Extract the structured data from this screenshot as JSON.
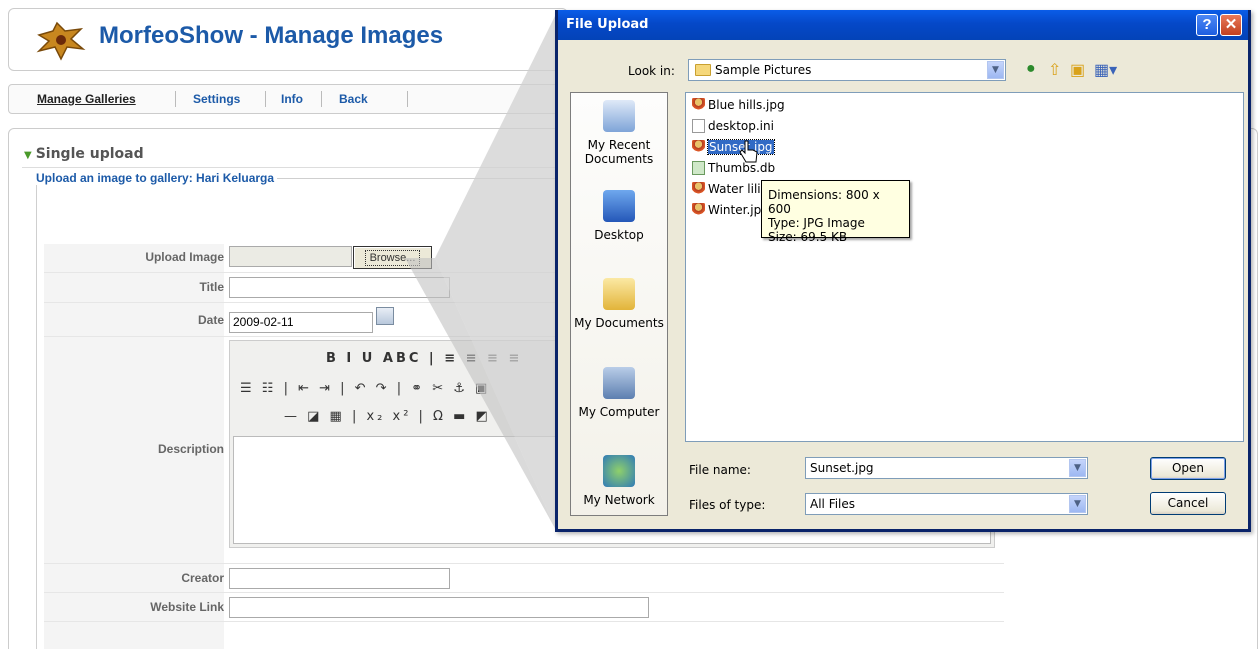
{
  "page": {
    "title": "MorfeoShow - Manage Images",
    "nav": [
      "Manage Galleries",
      "Settings",
      "Info",
      "Back"
    ],
    "section_title": "Single upload",
    "legend": "Upload an image to gallery: Hari Keluarga",
    "fields": {
      "upload_image_label": "Upload Image",
      "browse_label": "Browse...",
      "title_label": "Title",
      "title_value": "",
      "date_label": "Date",
      "date_value": "2009-02-11",
      "description_label": "Description",
      "creator_label": "Creator",
      "creator_value": "",
      "website_label": "Website Link",
      "website_value": ""
    },
    "editor_toolbar": {
      "row1": "B I U ABC | ≡ ≡ ≡ ≡",
      "row2": "☰ ☷ | ⇤ ⇥ | ↶ ↷ | ⚭ ✂ ⚓ ▣",
      "row3": "— ◪ ▦ | x₂ x² | Ω ▬ ◩"
    }
  },
  "dialog": {
    "title": "File Upload",
    "help_label": "?",
    "close_label": "✕",
    "look_in_label": "Look in:",
    "look_in_value": "Sample Pictures",
    "places": [
      "My Recent Documents",
      "Desktop",
      "My Documents",
      "My Computer",
      "My Network"
    ],
    "files": [
      {
        "name": "Blue hills.jpg",
        "type": "img"
      },
      {
        "name": "desktop.ini",
        "type": "doc"
      },
      {
        "name": "Sunset.jpg",
        "type": "img",
        "selected": true
      },
      {
        "name": "Thumbs.db",
        "type": "db"
      },
      {
        "name": "Water lilies.jpg",
        "type": "img"
      },
      {
        "name": "Winter.jpg",
        "type": "img"
      }
    ],
    "tooltip": [
      "Dimensions: 800 x 600",
      "Type: JPG Image",
      "Size: 69.5 KB"
    ],
    "file_name_label": "File name:",
    "file_name_value": "Sunset.jpg",
    "file_type_label": "Files of type:",
    "file_type_value": "All Files",
    "open_label": "Open",
    "cancel_label": "Cancel"
  },
  "colors": {
    "title_blue": "#1c5aa8",
    "xp_title": "#0548c8",
    "selection": "#316ac5",
    "tooltip_bg": "#ffffe1"
  }
}
